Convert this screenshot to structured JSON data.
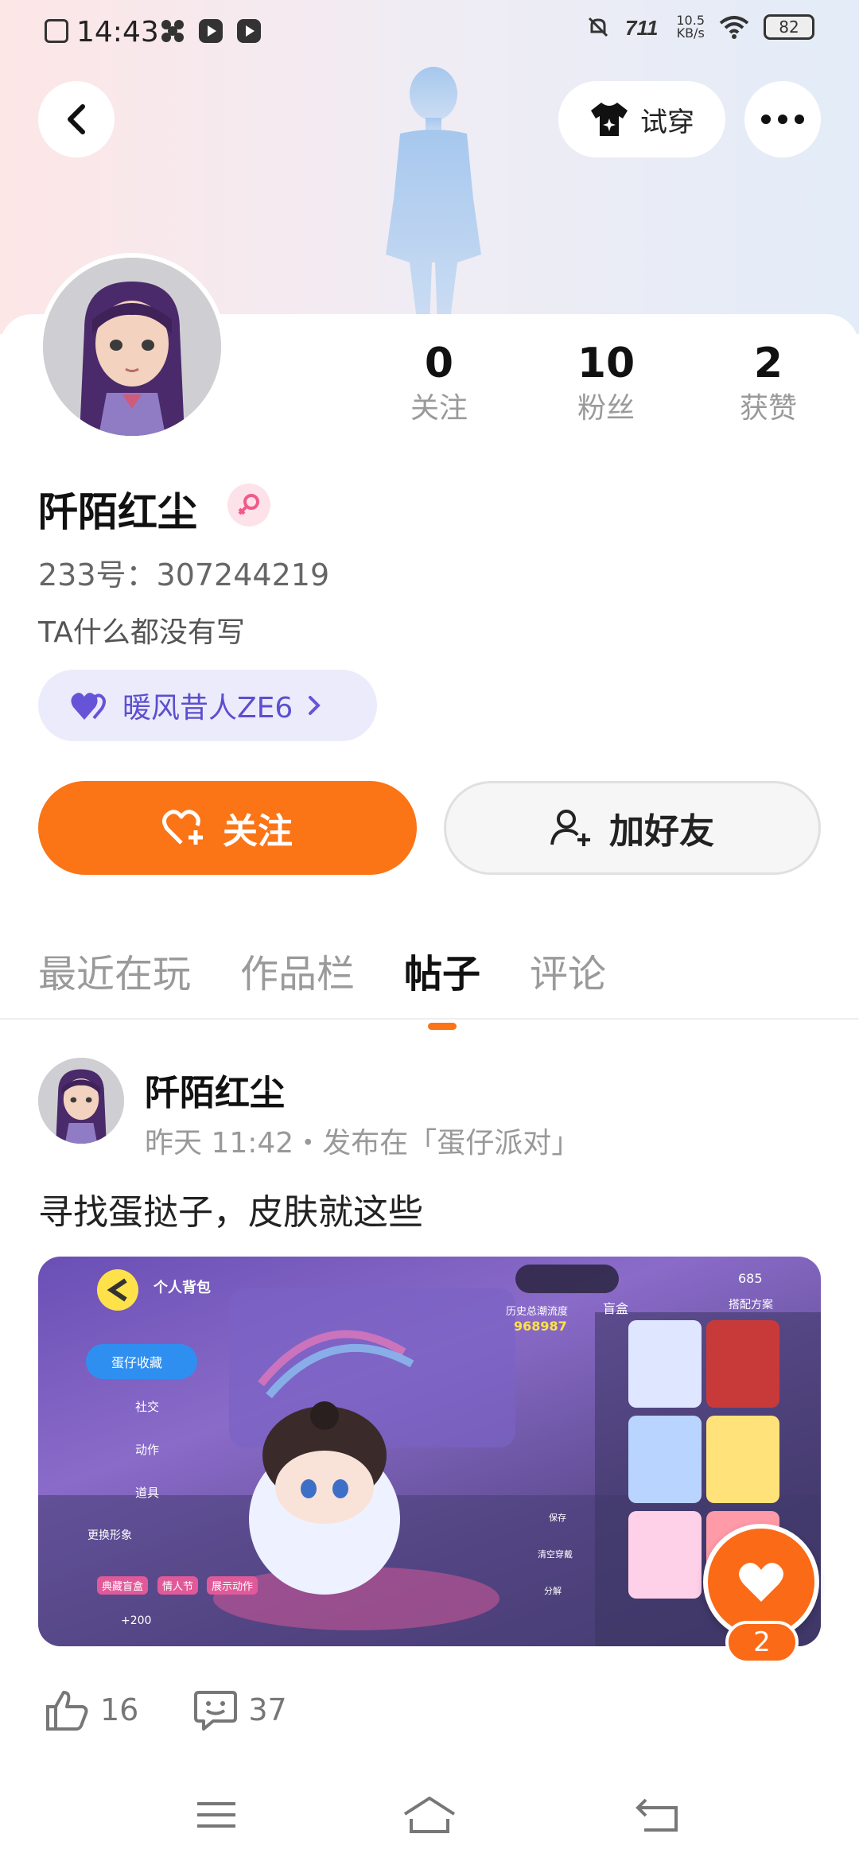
{
  "status_bar": {
    "time": "14:43",
    "net_speed_value": "10.5",
    "net_speed_unit": "KB/s",
    "battery": "82"
  },
  "header": {
    "try_on_label": "试穿"
  },
  "profile": {
    "name": "阡陌红尘",
    "id_text": "233号：307244219",
    "bio": "TA什么都没有写",
    "group_chip": "暖风昔人ZE6",
    "stats": [
      {
        "value": "0",
        "label": "关注"
      },
      {
        "value": "10",
        "label": "粉丝"
      },
      {
        "value": "2",
        "label": "获赞"
      }
    ],
    "follow_label": "关注",
    "add_friend_label": "加好友"
  },
  "tabs": [
    "最近在玩",
    "作品栏",
    "帖子",
    "评论"
  ],
  "active_tab": "帖子",
  "post": {
    "author": "阡陌红尘",
    "meta": "昨天 11:42・发布在「蛋仔派对」",
    "text": "寻找蛋挞子，皮肤就这些",
    "favorite_count": "2",
    "likes": "16",
    "comments": "37",
    "image_texts": {
      "bag_title": "个人背包",
      "menu": [
        "蛋仔收藏",
        "社交",
        "动作",
        "道具"
      ],
      "coin": "685",
      "history_label": "历史总潮流度",
      "history_value": "968987",
      "blind_box": "盲盒",
      "match_plan": "搭配方案",
      "change_look": "更换形象",
      "bottom_tabs": [
        "典藏盲盒",
        "情人节",
        "展示动作"
      ],
      "plus_value": "+200",
      "side_actions": [
        "保存",
        "清空穿戴",
        "分解"
      ]
    }
  },
  "colors": {
    "accent": "#fb7416",
    "chip_bg": "#ecebfb",
    "chip_text": "#5b4fd0"
  }
}
